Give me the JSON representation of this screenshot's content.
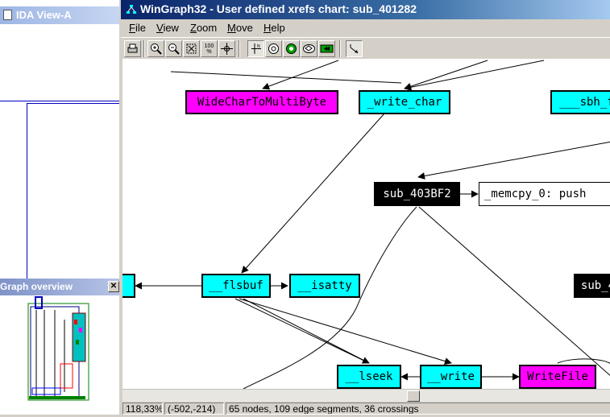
{
  "ida_view": {
    "title": "IDA View-A"
  },
  "graph_overview": {
    "title": "Graph overview",
    "close_glyph": "✕"
  },
  "window": {
    "title": "WinGraph32 - User defined xrefs chart: sub_401282",
    "icon": "graph-app-icon"
  },
  "menu": [
    "File",
    "View",
    "Zoom",
    "Move",
    "Help"
  ],
  "toolbar": {
    "buttons": [
      {
        "name": "print-icon"
      },
      {
        "name": "zoom-in-icon"
      },
      {
        "name": "zoom-out-icon"
      },
      {
        "name": "fit-window-icon"
      },
      {
        "name": "zoom-100-icon",
        "label": "100\n%"
      },
      {
        "name": "center-icon"
      },
      {
        "name": "origin-icon"
      },
      {
        "name": "overview-icon"
      },
      {
        "name": "layout-icon"
      },
      {
        "name": "relayout-icon"
      },
      {
        "name": "fold-icon"
      },
      {
        "name": "edge-follow-icon"
      }
    ]
  },
  "nodes": [
    {
      "id": "n1",
      "label": "WideCharToMultiByte",
      "color": "magenta"
    },
    {
      "id": "n2",
      "label": "_write_char",
      "color": "cyan"
    },
    {
      "id": "n3",
      "label": "___sbh_f",
      "color": "cyan"
    },
    {
      "id": "n4",
      "label": "sub_403BF2",
      "color": "black"
    },
    {
      "id": "n5",
      "label": "_memcpy_0: push",
      "color": "white"
    },
    {
      "id": "n6",
      "label": "__flsbuf",
      "color": "cyan"
    },
    {
      "id": "n7",
      "label": "__isatty",
      "color": "cyan"
    },
    {
      "id": "n8",
      "label": "",
      "color": "cyan"
    },
    {
      "id": "n9",
      "label": "sub_4",
      "color": "black"
    },
    {
      "id": "n10",
      "label": "__lseek",
      "color": "cyan"
    },
    {
      "id": "n11",
      "label": "__write",
      "color": "cyan"
    },
    {
      "id": "n12",
      "label": "WriteFile",
      "color": "magenta"
    }
  ],
  "colors": {
    "cyan": "#00ffff",
    "magenta": "#ff00ff",
    "black": "#000000",
    "title_bar": "#0a246a"
  },
  "status": {
    "zoom": "118,33%",
    "coords": "(-502,-214)",
    "summary": "65 nodes, 109 edge segments, 36 crossings"
  }
}
